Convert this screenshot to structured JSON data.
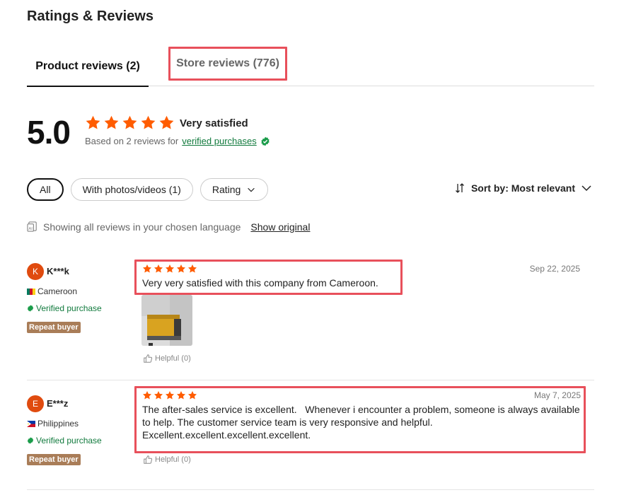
{
  "page": {
    "title": "Ratings & Reviews"
  },
  "tabs": [
    {
      "label": "Product reviews (2)"
    },
    {
      "label": "Store reviews (776)"
    }
  ],
  "summary": {
    "score": "5.0",
    "stars": 5,
    "satisfaction": "Very satisfied",
    "based_on": "Based on 2 reviews for",
    "verified_link": "verified purchases"
  },
  "filters": {
    "all": "All",
    "photos": "With photos/videos (1)",
    "rating": "Rating"
  },
  "sort": {
    "label": "Sort by: Most relevant"
  },
  "language": {
    "notice": "Showing all reviews in your chosen language",
    "show_original": "Show original"
  },
  "reviews": [
    {
      "initial": "K",
      "name": "K***k",
      "country": "Cameroon",
      "verified": "Verified purchase",
      "badge": "Repeat buyer",
      "stars": 5,
      "date": "Sep 22, 2025",
      "text": "Very very satisfied with this company from Cameroon.",
      "helpful": "Helpful (0)"
    },
    {
      "initial": "E",
      "name": "E***z",
      "country": "Philippines",
      "verified": "Verified purchase",
      "badge": "Repeat buyer",
      "stars": 5,
      "date": "May 7, 2025",
      "text_lines": [
        "The after-sales service is excellent.   Whenever i encounter a problem, someone is always available",
        "to help. The customer service team is very responsive and helpful.",
        "Excellent.excellent.excellent.excellent."
      ],
      "helpful": "Helpful (0)"
    }
  ],
  "colors": {
    "star": "#ff5c00",
    "highlight": "#e8505b",
    "verified": "#117a3d",
    "badge": "#a97d58"
  }
}
